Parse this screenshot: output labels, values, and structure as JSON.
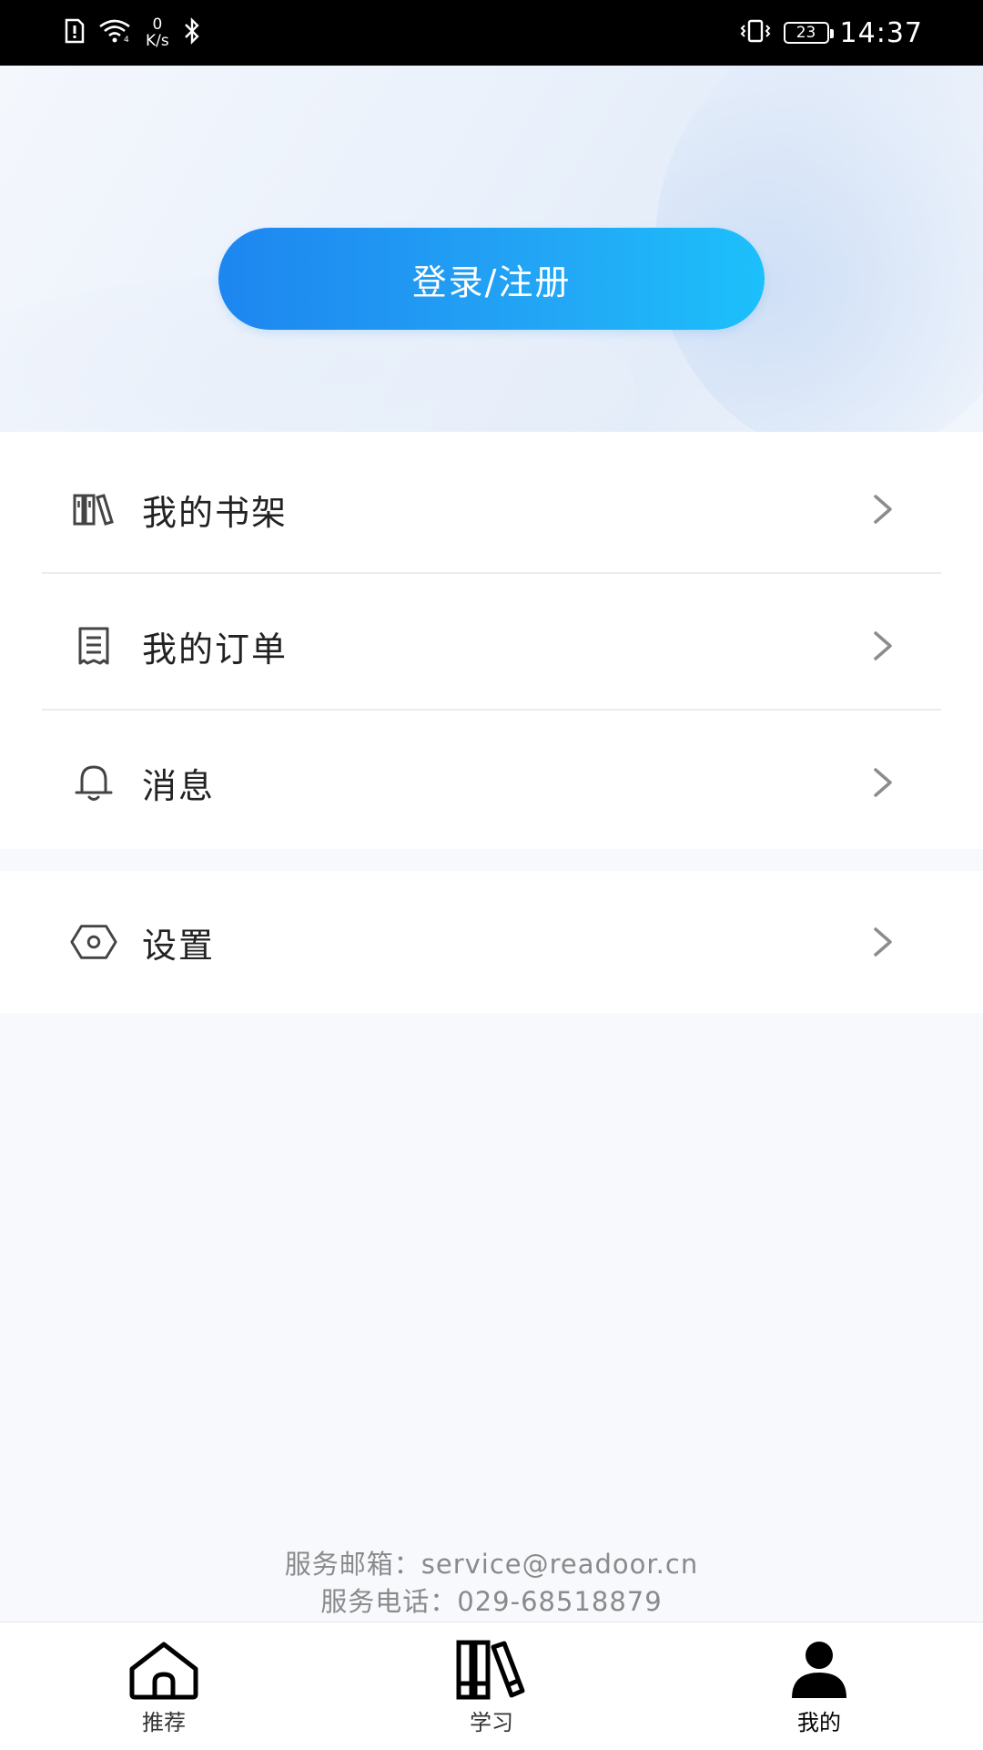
{
  "status_bar": {
    "speed_value": "0",
    "speed_unit": "K/s",
    "battery": "23",
    "time": "14:37"
  },
  "header": {
    "login_label": "登录/注册"
  },
  "menu": {
    "items": [
      {
        "label": "我的书架",
        "icon": "bookshelf-icon"
      },
      {
        "label": "我的订单",
        "icon": "order-icon"
      },
      {
        "label": "消息",
        "icon": "bell-icon"
      }
    ],
    "settings": {
      "label": "设置",
      "icon": "settings-icon"
    }
  },
  "contact": {
    "email_line": "服务邮箱：service@readoor.cn",
    "phone_line": "服务电话：029-68518879"
  },
  "tabbar": {
    "tabs": [
      {
        "label": "推荐",
        "icon": "home-icon"
      },
      {
        "label": "学习",
        "icon": "books-icon"
      },
      {
        "label": "我的",
        "icon": "user-icon"
      }
    ],
    "active_index": 2
  },
  "colors": {
    "accent_start": "#1d86f0",
    "accent_end": "#1cc0fb",
    "text": "#222222",
    "muted": "#8a8a8a"
  }
}
